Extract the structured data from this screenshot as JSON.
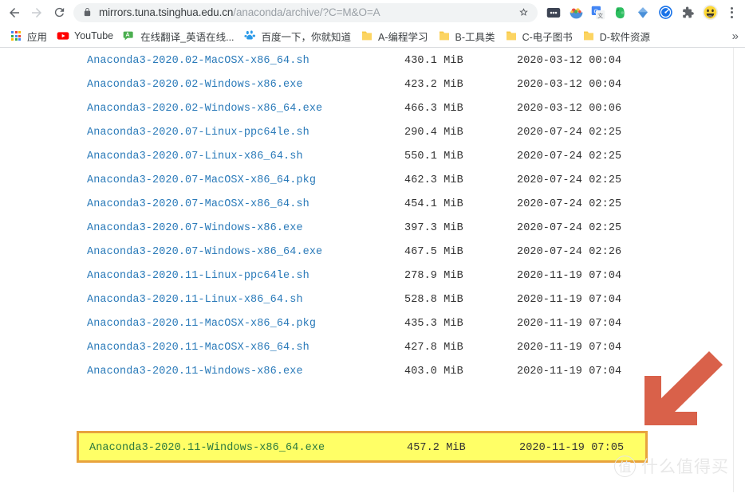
{
  "browser": {
    "nav": {
      "back_label": "Back",
      "forward_label": "Forward",
      "reload_label": "Reload"
    },
    "omnibox": {
      "host": "mirrors.tuna.tsinghua.edu.cn",
      "path": "/anaconda/archive/?C=M&O=A",
      "full_url": "mirrors.tuna.tsinghua.edu.cn/anaconda/archive/?C=M&O=A",
      "lock_icon": "lock-icon",
      "star_icon": "star-icon"
    },
    "extensions": [
      {
        "name": "dots-extension-icon",
        "label": ""
      },
      {
        "name": "bowl-extension-icon",
        "label": ""
      },
      {
        "name": "google-translate-icon",
        "label": ""
      },
      {
        "name": "evernote-icon",
        "label": ""
      },
      {
        "name": "diamond-extension-icon",
        "label": ""
      },
      {
        "name": "speed-extension-icon",
        "label": ""
      },
      {
        "name": "puzzle-extensions-icon",
        "label": ""
      },
      {
        "name": "profile-avatar",
        "label": ""
      }
    ],
    "menu_label": "Customize and control Google Chrome"
  },
  "bookmarks": {
    "items": [
      {
        "label": "应用",
        "icon": "apps-grid-icon"
      },
      {
        "label": "YouTube",
        "icon": "youtube-icon"
      },
      {
        "label": "在线翻译_英语在线...",
        "icon": "translate-bookmark-icon"
      },
      {
        "label": "百度一下，你就知道",
        "icon": "baidu-icon"
      },
      {
        "label": "A-编程学习",
        "icon": "folder-icon"
      },
      {
        "label": "B-工具类",
        "icon": "folder-icon"
      },
      {
        "label": "C-电子图书",
        "icon": "folder-icon"
      },
      {
        "label": "D-软件资源",
        "icon": "folder-icon"
      }
    ],
    "overflow_label": "»"
  },
  "listing": {
    "rows": [
      {
        "name": "Anaconda3-2020.02-MacOSX-x86_64.sh",
        "size": "430.1 MiB",
        "date": "2020-03-12 00:04"
      },
      {
        "name": "Anaconda3-2020.02-Windows-x86.exe",
        "size": "423.2 MiB",
        "date": "2020-03-12 00:04"
      },
      {
        "name": "Anaconda3-2020.02-Windows-x86_64.exe",
        "size": "466.3 MiB",
        "date": "2020-03-12 00:06"
      },
      {
        "name": "Anaconda3-2020.07-Linux-ppc64le.sh",
        "size": "290.4 MiB",
        "date": "2020-07-24 02:25"
      },
      {
        "name": "Anaconda3-2020.07-Linux-x86_64.sh",
        "size": "550.1 MiB",
        "date": "2020-07-24 02:25"
      },
      {
        "name": "Anaconda3-2020.07-MacOSX-x86_64.pkg",
        "size": "462.3 MiB",
        "date": "2020-07-24 02:25"
      },
      {
        "name": "Anaconda3-2020.07-MacOSX-x86_64.sh",
        "size": "454.1 MiB",
        "date": "2020-07-24 02:25"
      },
      {
        "name": "Anaconda3-2020.07-Windows-x86.exe",
        "size": "397.3 MiB",
        "date": "2020-07-24 02:25"
      },
      {
        "name": "Anaconda3-2020.07-Windows-x86_64.exe",
        "size": "467.5 MiB",
        "date": "2020-07-24 02:26"
      },
      {
        "name": "Anaconda3-2020.11-Linux-ppc64le.sh",
        "size": "278.9 MiB",
        "date": "2020-11-19 07:04"
      },
      {
        "name": "Anaconda3-2020.11-Linux-x86_64.sh",
        "size": "528.8 MiB",
        "date": "2020-11-19 07:04"
      },
      {
        "name": "Anaconda3-2020.11-MacOSX-x86_64.pkg",
        "size": "435.3 MiB",
        "date": "2020-11-19 07:04"
      },
      {
        "name": "Anaconda3-2020.11-MacOSX-x86_64.sh",
        "size": "427.8 MiB",
        "date": "2020-11-19 07:04"
      },
      {
        "name": "Anaconda3-2020.11-Windows-x86.exe",
        "size": "403.0 MiB",
        "date": "2020-11-19 07:04"
      }
    ],
    "highlighted_row": {
      "name": "Anaconda3-2020.11-Windows-x86_64.exe",
      "size": "457.2 MiB",
      "date": "2020-11-19 07:05"
    }
  },
  "annotations": {
    "arrow": {
      "name": "down-left-arrow",
      "color": "#d9614a"
    }
  },
  "watermark": {
    "logo_char": "值",
    "text": "什么值得买"
  },
  "colors": {
    "link": "#2a7ab9",
    "highlight_fill": "#ffff66",
    "highlight_border": "#e8a33d",
    "highlight_text": "#2c7a3f",
    "arrow": "#d9614a",
    "omnibox_bg": "#f1f3f4"
  }
}
